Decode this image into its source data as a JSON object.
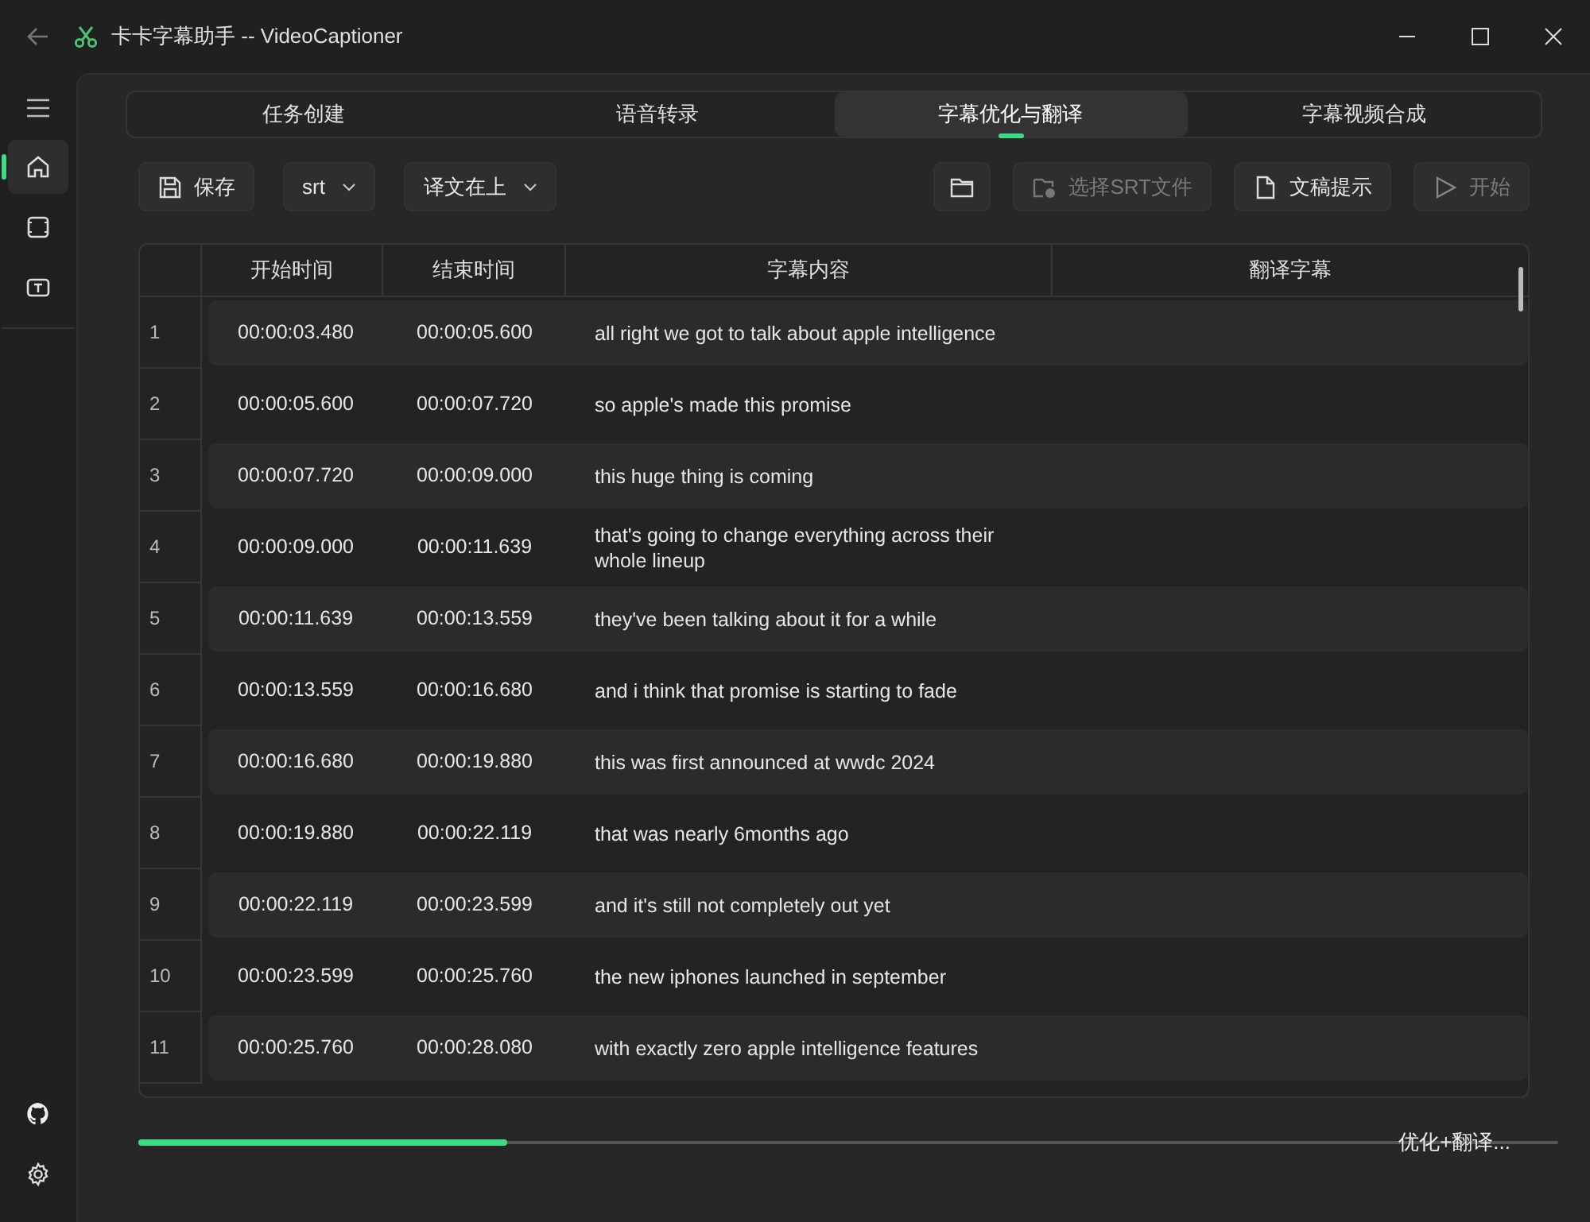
{
  "window": {
    "title": "卡卡字幕助手 -- VideoCaptioner"
  },
  "sidebar": {
    "items": [
      {
        "kind": "home",
        "selected": true
      },
      {
        "kind": "film",
        "selected": false
      },
      {
        "kind": "text",
        "selected": false
      }
    ],
    "bottom": [
      {
        "kind": "github"
      },
      {
        "kind": "settings"
      }
    ]
  },
  "tabs": [
    {
      "label": "任务创建",
      "selected": false
    },
    {
      "label": "语音转录",
      "selected": false
    },
    {
      "label": "字幕优化与翻译",
      "selected": true
    },
    {
      "label": "字幕视频合成",
      "selected": false
    }
  ],
  "toolbar": {
    "left": [
      {
        "kind": "save",
        "label": "保存"
      },
      {
        "kind": "dropdown",
        "label": "srt"
      },
      {
        "kind": "dropdown",
        "label": "译文在上"
      }
    ],
    "right": [
      {
        "kind": "folder"
      },
      {
        "kind": "file-add",
        "label": "选择SRT文件",
        "disabled": true
      },
      {
        "kind": "doc",
        "label": "文稿提示",
        "disabled": false
      },
      {
        "kind": "play",
        "label": "开始",
        "disabled": true
      }
    ]
  },
  "table": {
    "columns": [
      "开始时间",
      "结束时间",
      "字幕内容",
      "翻译字幕"
    ],
    "rows": [
      {
        "index": "1",
        "start": "00:00:03.480",
        "end": "00:00:05.600",
        "text": "all right we got to talk about apple intelligence"
      },
      {
        "index": "2",
        "start": "00:00:05.600",
        "end": "00:00:07.720",
        "text": "so apple's made this promise"
      },
      {
        "index": "3",
        "start": "00:00:07.720",
        "end": "00:00:09.000",
        "text": "this huge thing is coming"
      },
      {
        "index": "4",
        "start": "00:00:09.000",
        "end": "00:00:11.639",
        "text": "that's going to change everything  across their whole lineup"
      },
      {
        "index": "5",
        "start": "00:00:11.639",
        "end": "00:00:13.559",
        "text": "they've been talking about it for a while"
      },
      {
        "index": "6",
        "start": "00:00:13.559",
        "end": "00:00:16.680",
        "text": "and i think that promise is starting to fade"
      },
      {
        "index": "7",
        "start": "00:00:16.680",
        "end": "00:00:19.880",
        "text": "this was first announced at wwdc 2024"
      },
      {
        "index": "8",
        "start": "00:00:19.880",
        "end": "00:00:22.119",
        "text": "that was nearly 6months ago"
      },
      {
        "index": "9",
        "start": "00:00:22.119",
        "end": "00:00:23.599",
        "text": "and it's still not completely out yet"
      },
      {
        "index": "10",
        "start": "00:00:23.599",
        "end": "00:00:25.760",
        "text": "the new iphones launched in september"
      },
      {
        "index": "11",
        "start": "00:00:25.760",
        "end": "00:00:28.080",
        "text": "with exactly zero apple intelligence features"
      }
    ]
  },
  "progress": {
    "level": 0.26,
    "status": "优化+翻译..."
  }
}
